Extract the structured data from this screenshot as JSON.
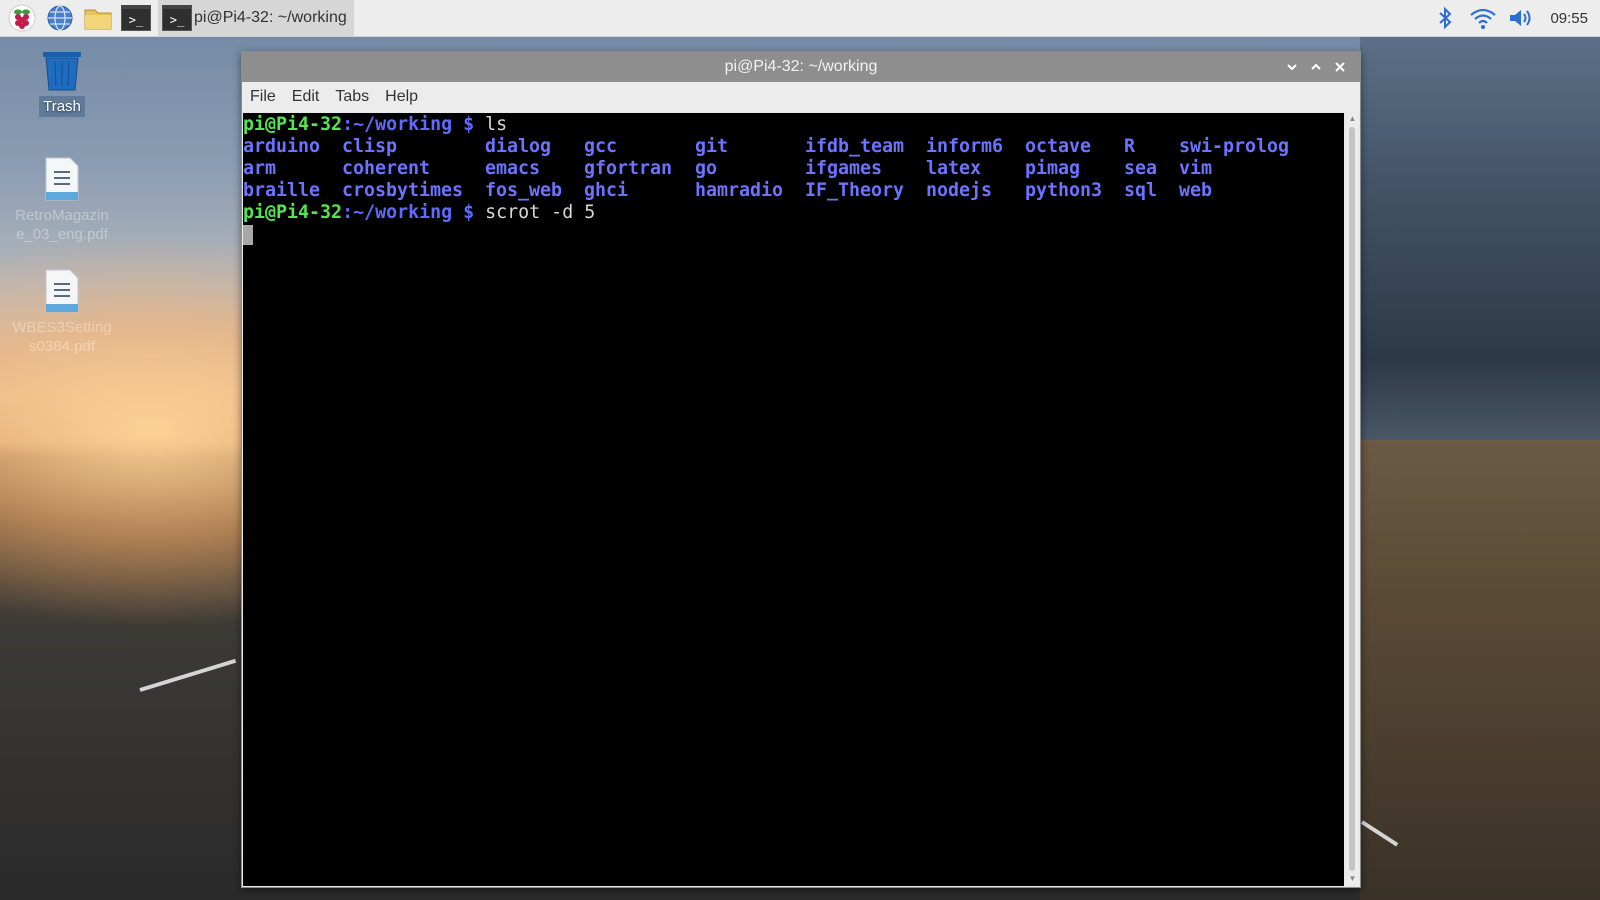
{
  "taskbar": {
    "launchers": [
      {
        "name": "raspberry-menu-icon"
      },
      {
        "name": "web-browser-icon"
      },
      {
        "name": "file-manager-icon"
      },
      {
        "name": "terminal-icon"
      }
    ],
    "task": {
      "label": "pi@Pi4-32: ~/working"
    },
    "tray": {
      "icons": [
        "bluetooth-icon",
        "wifi-icon",
        "volume-icon"
      ],
      "clock": "09:55"
    }
  },
  "desktop": {
    "icons": [
      {
        "label": "Trash"
      },
      {
        "label": "RetroMagazine_03_eng.pdf"
      },
      {
        "label": "WBES3Settings0384.pdf"
      }
    ]
  },
  "window": {
    "title": "pi@Pi4-32: ~/working",
    "menu": [
      "File",
      "Edit",
      "Tabs",
      "Help"
    ],
    "terminal": {
      "prompt_user": "pi@Pi4-32",
      "prompt_path": ":~/working $",
      "cmd1": " ls",
      "ls_rows": [
        [
          "arduino",
          "clisp",
          "dialog",
          "gcc",
          "git",
          "ifdb_team",
          "inform6",
          "octave",
          "R",
          "swi-prolog"
        ],
        [
          "arm",
          "coherent",
          "emacs",
          "gfortran",
          "go",
          "ifgames",
          "latex",
          "pimag",
          "sea",
          "vim"
        ],
        [
          "braille",
          "crosbytimes",
          "fos_web",
          "ghci",
          "hamradio",
          "IF_Theory",
          "nodejs",
          "python3",
          "sql",
          "web"
        ]
      ],
      "cmd2": " scrot -d 5"
    }
  }
}
